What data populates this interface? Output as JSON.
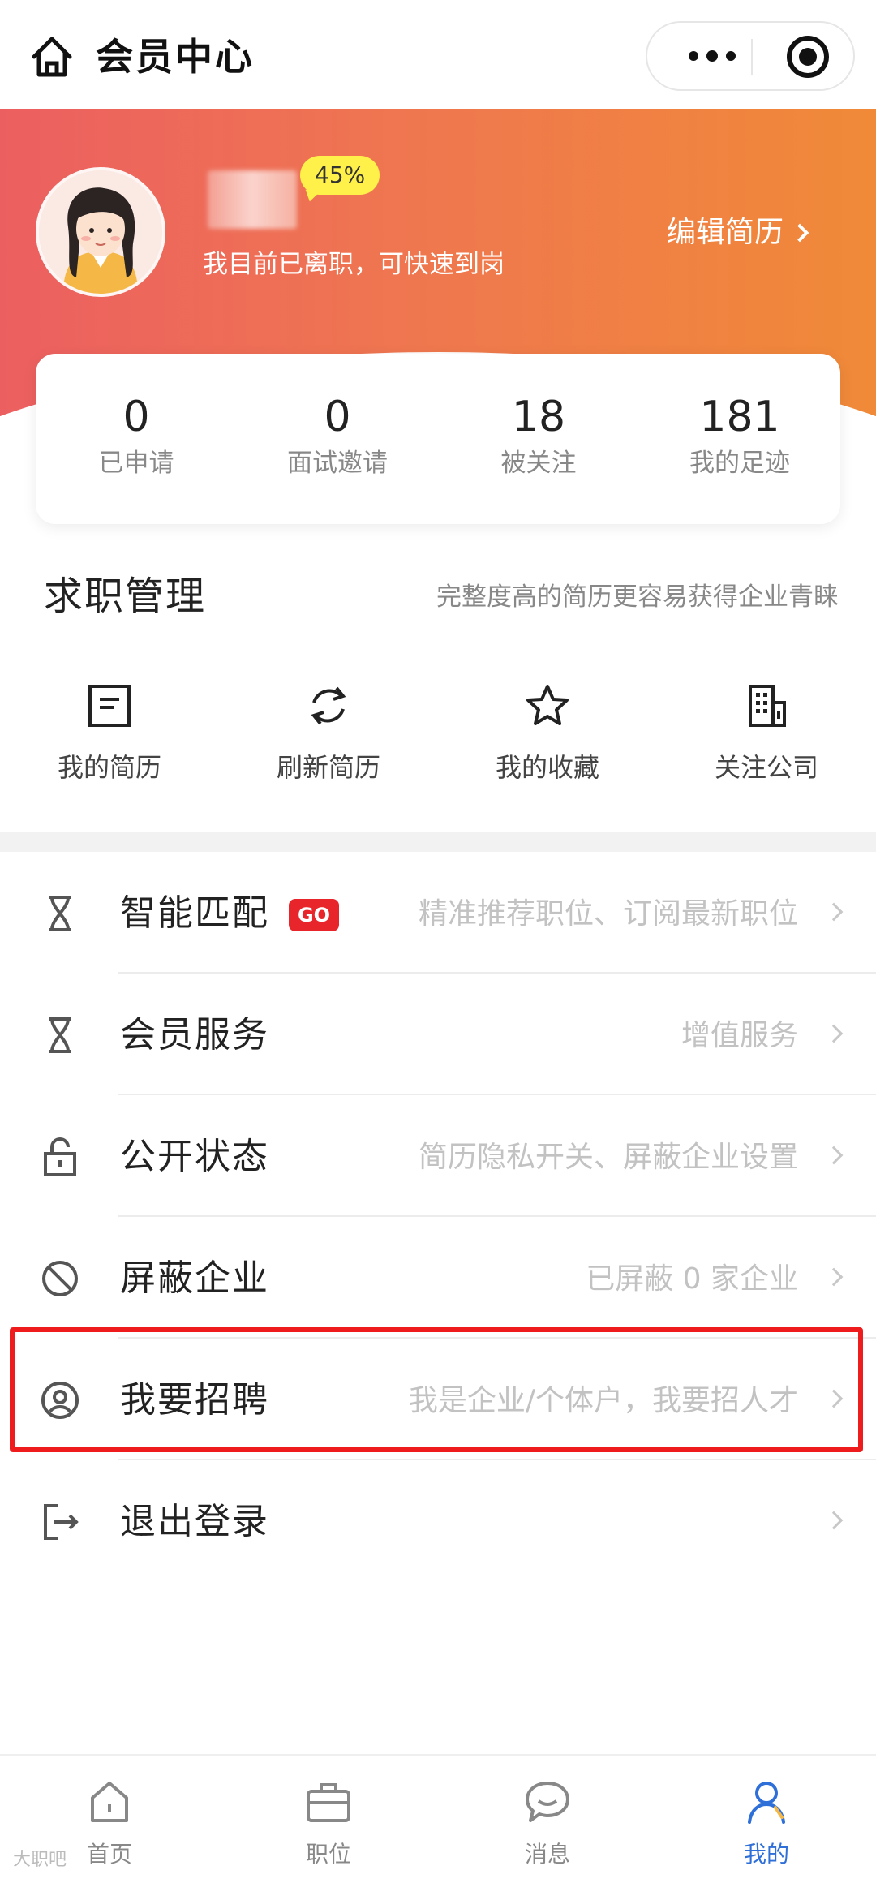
{
  "titlebar": {
    "title": "会员中心"
  },
  "profile": {
    "completion": "45%",
    "status": "我目前已离职，可快速到岗",
    "edit_label": "编辑简历"
  },
  "stats": [
    {
      "value": "0",
      "label": "已申请"
    },
    {
      "value": "0",
      "label": "面试邀请"
    },
    {
      "value": "18",
      "label": "被关注"
    },
    {
      "value": "181",
      "label": "我的足迹"
    }
  ],
  "section": {
    "title": "求职管理",
    "subtitle": "完整度高的简历更容易获得企业青睐"
  },
  "quick_actions": [
    {
      "label": "我的简历",
      "icon": "resume-icon"
    },
    {
      "label": "刷新简历",
      "icon": "refresh-icon"
    },
    {
      "label": "我的收藏",
      "icon": "star-icon"
    },
    {
      "label": "关注公司",
      "icon": "building-icon"
    }
  ],
  "menu": [
    {
      "title": "智能匹配",
      "badge": "GO",
      "desc": "精准推荐职位、订阅最新职位",
      "icon": "dna-icon"
    },
    {
      "title": "会员服务",
      "desc": "增值服务",
      "icon": "dna-icon"
    },
    {
      "title": "公开状态",
      "desc": "简历隐私开关、屏蔽企业设置",
      "icon": "lock-icon"
    },
    {
      "title": "屏蔽企业",
      "desc": "已屏蔽 0 家企业",
      "icon": "block-icon"
    },
    {
      "title": "我要招聘",
      "desc": "我是企业/个体户，我要招人才",
      "icon": "user-circle-icon"
    },
    {
      "title": "退出登录",
      "desc": "",
      "icon": "logout-icon"
    }
  ],
  "tabbar": [
    {
      "label": "首页",
      "icon": "home-icon"
    },
    {
      "label": "职位",
      "icon": "briefcase-icon"
    },
    {
      "label": "消息",
      "icon": "chat-icon"
    },
    {
      "label": "我的",
      "icon": "person-icon",
      "active": true
    }
  ],
  "colors": {
    "accent": "#2f6fd8",
    "hero_start": "#ec5f61",
    "hero_end": "#f08a38",
    "badge_red": "#e8252a",
    "highlight": "#ee1c1c"
  },
  "watermark": "大职吧"
}
